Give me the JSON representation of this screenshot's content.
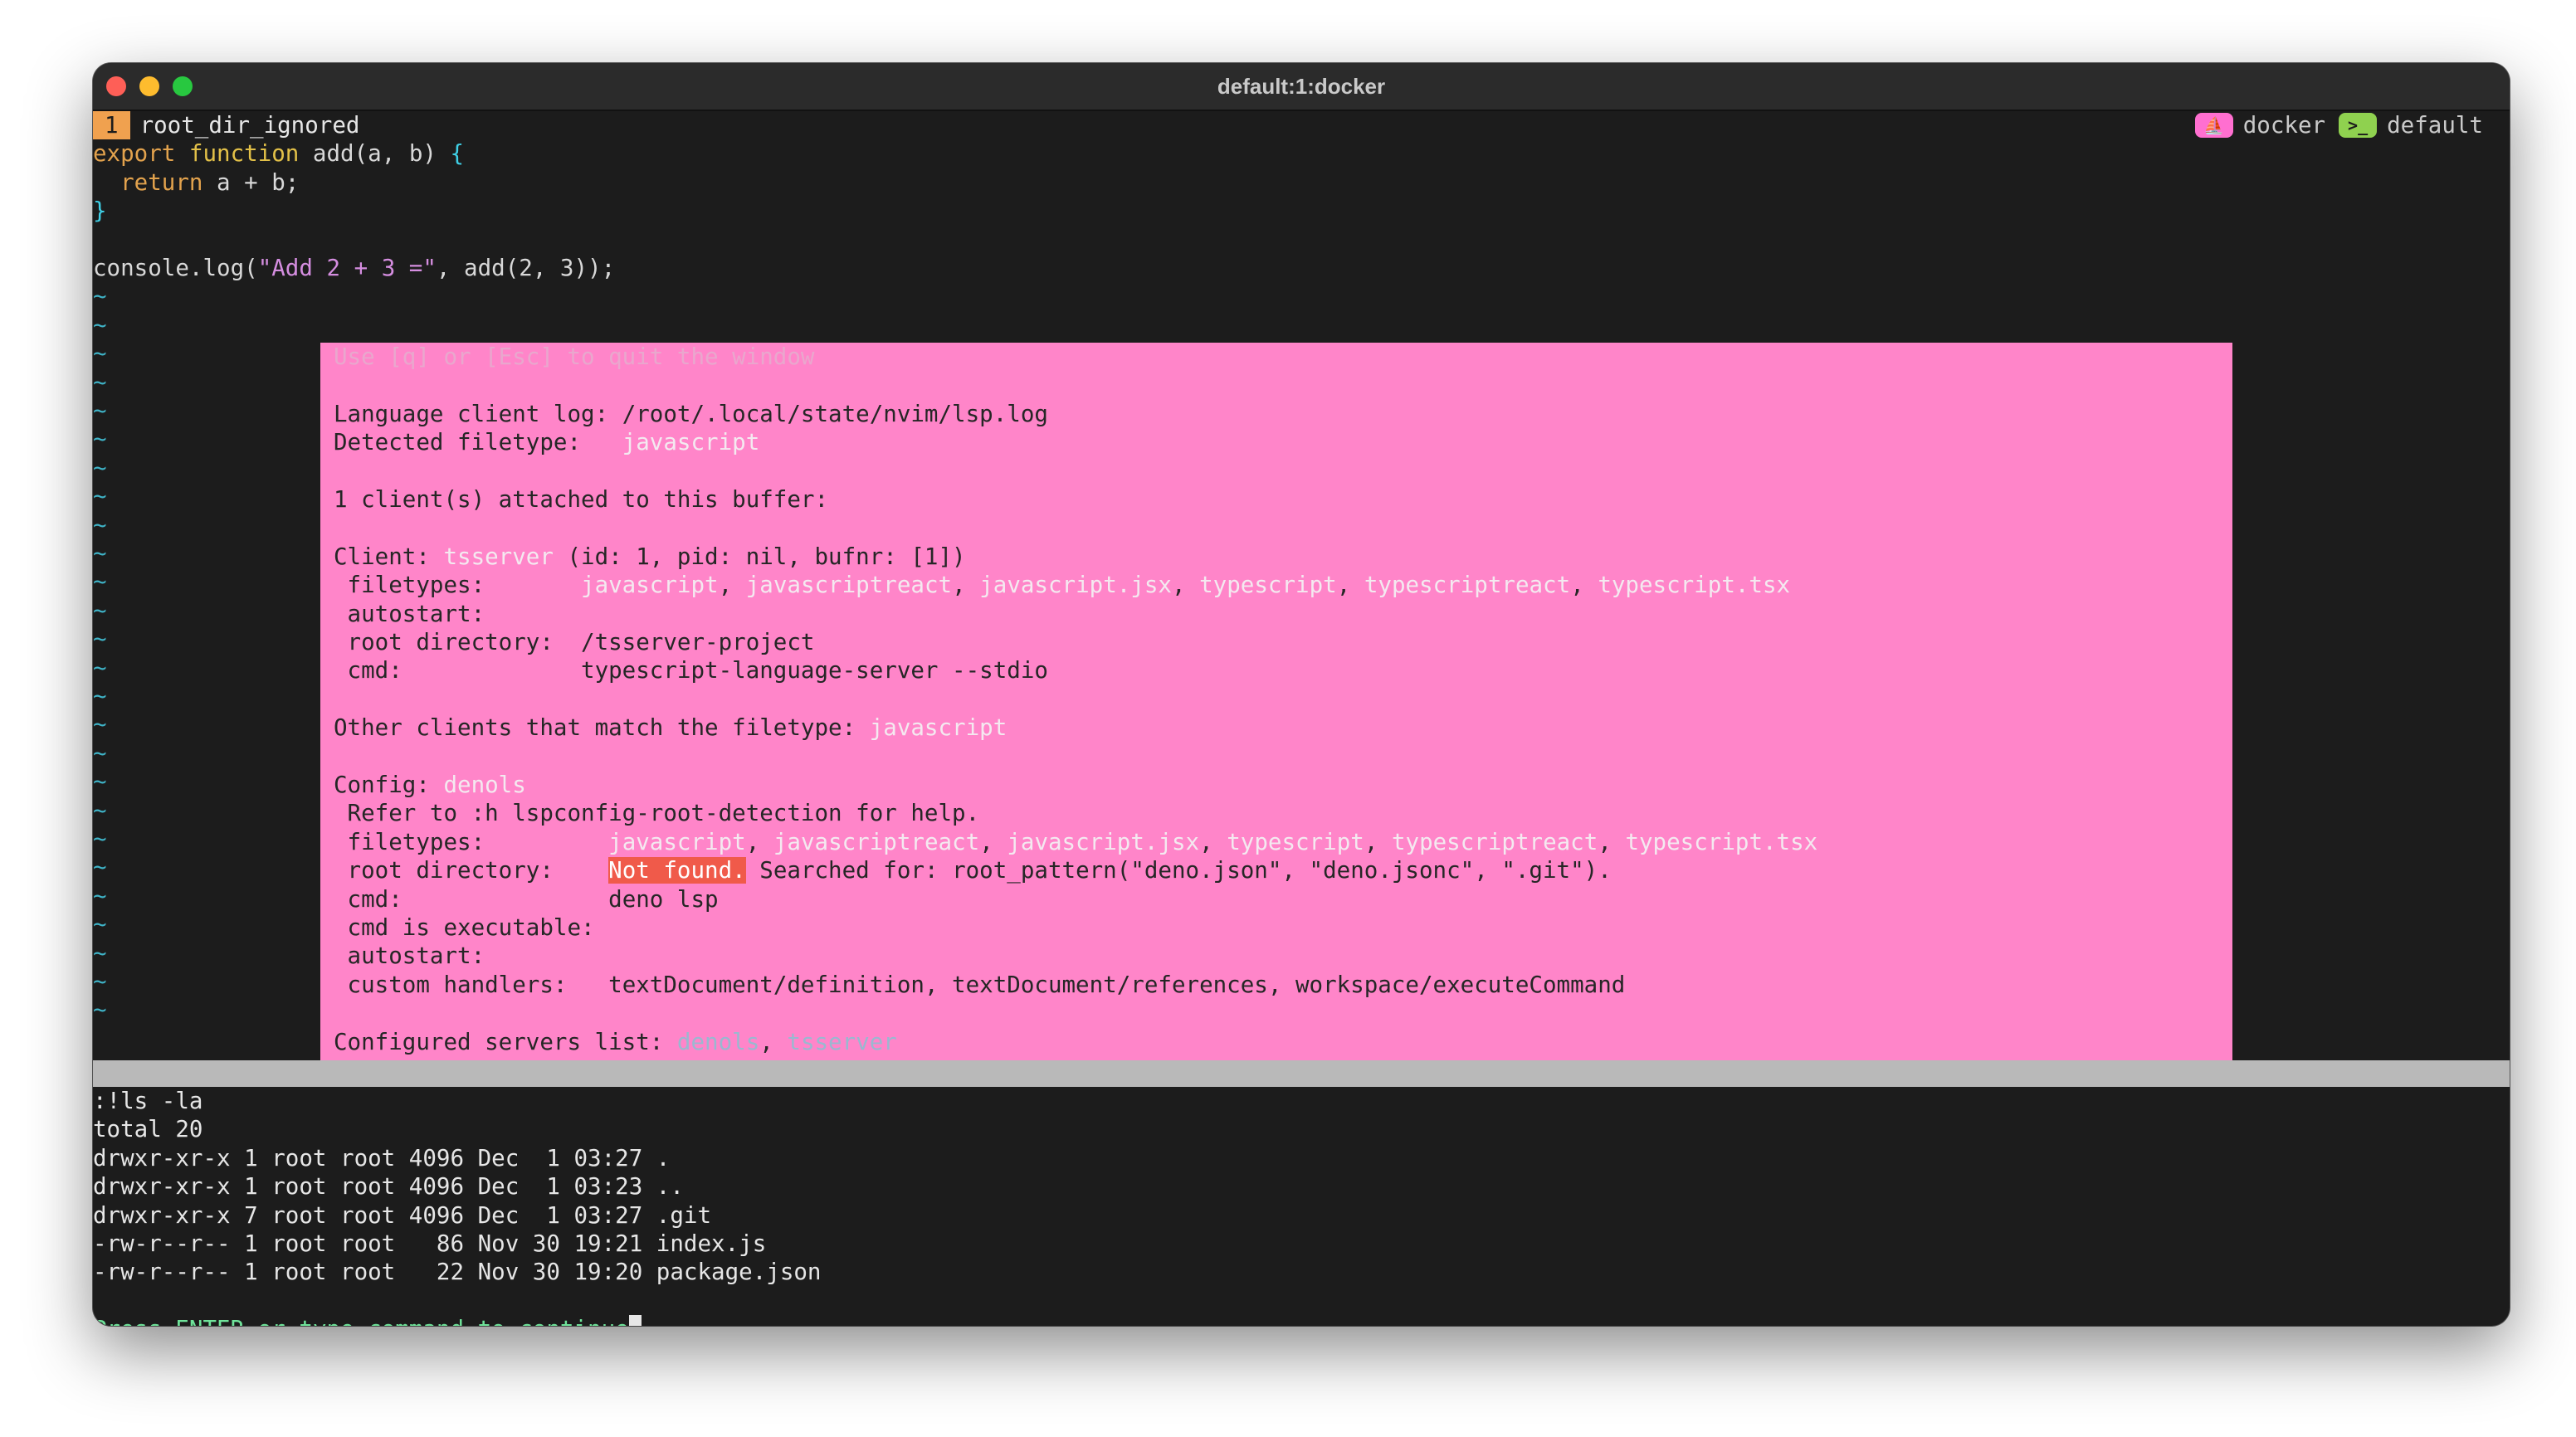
{
  "window": {
    "title": "default:1:docker"
  },
  "tmux": {
    "tab_number": "1",
    "tab_name": "root_dir_ignored",
    "right_tabs": [
      {
        "icon": "docker-icon",
        "label": "docker",
        "color": "#ff6fd0"
      },
      {
        "icon": "terminal-icon",
        "label": "default",
        "color": "#8fd14f"
      }
    ]
  },
  "code": {
    "line1": {
      "kw1": "export",
      "kw2": "function",
      "name": "add(a, b) ",
      "brace": "{"
    },
    "line2": {
      "indent": "  ",
      "kw": "return",
      "rest": " a + b;"
    },
    "line3": {
      "brace": "}"
    },
    "line5": {
      "prefix": "console.log(",
      "string": "\"Add 2 + 3 =\"",
      "suffix": ", add(2, 3));"
    }
  },
  "popup": {
    "hint": "Use [q] or [Esc] to quit the window",
    "log_label": "Language client log: ",
    "log_path": "/root/.local/state/nvim/lsp.log",
    "filetype_label": "Detected filetype:   ",
    "filetype": "javascript",
    "attached": "1 client(s) attached to this buffer:",
    "client_label": "Client: ",
    "client_name": "tsserver",
    "client_info": " (id: 1, pid: nil, bufnr: [1])",
    "ts_filetypes_label": " filetypes:       ",
    "ts_filetypes": [
      "javascript",
      "javascriptreact",
      "javascript.jsx",
      "typescript",
      "typescriptreact",
      "typescript.tsx"
    ],
    "ts_autostart": " autostart:",
    "ts_root_label": " root directory:  ",
    "ts_root": "/tsserver-project",
    "ts_cmd_label": " cmd:             ",
    "ts_cmd": "typescript-language-server --stdio",
    "other_label": "Other clients that match the filetype: ",
    "other_ft": "javascript",
    "config_label": "Config: ",
    "config_name": "denols",
    "refer": " Refer to :h lspconfig-root-detection for help.",
    "d_filetypes_label": " filetypes:         ",
    "d_filetypes": [
      "javascript",
      "javascriptreact",
      "javascript.jsx",
      "typescript",
      "typescriptreact",
      "typescript.tsx"
    ],
    "d_root_label": " root directory:    ",
    "d_not_found": "Not found.",
    "d_searched": " Searched for: root_pattern(\"deno.json\", \"deno.jsonc\", \".git\").",
    "d_cmd_label": " cmd:               ",
    "d_cmd": "deno lsp",
    "d_exec": " cmd is executable:",
    "d_autostart": " autostart:",
    "d_handlers_label": " custom handlers:   ",
    "d_handlers": "textDocument/definition, textDocument/references, workspace/executeCommand",
    "servers_label": "Configured servers list: ",
    "servers": [
      "denols",
      "tsserver"
    ]
  },
  "shell": {
    "command": ":!ls -la",
    "lines": [
      "total 20",
      "drwxr-xr-x 1 root root 4096 Dec  1 03:27 .",
      "drwxr-xr-x 1 root root 4096 Dec  1 03:23 ..",
      "drwxr-xr-x 7 root root 4096 Dec  1 03:27 .git",
      "-rw-r--r-- 1 root root   86 Nov 30 19:21 index.js",
      "-rw-r--r-- 1 root root   22 Nov 30 19:20 package.json"
    ],
    "prompt": "Press ENTER or type command to continue"
  }
}
